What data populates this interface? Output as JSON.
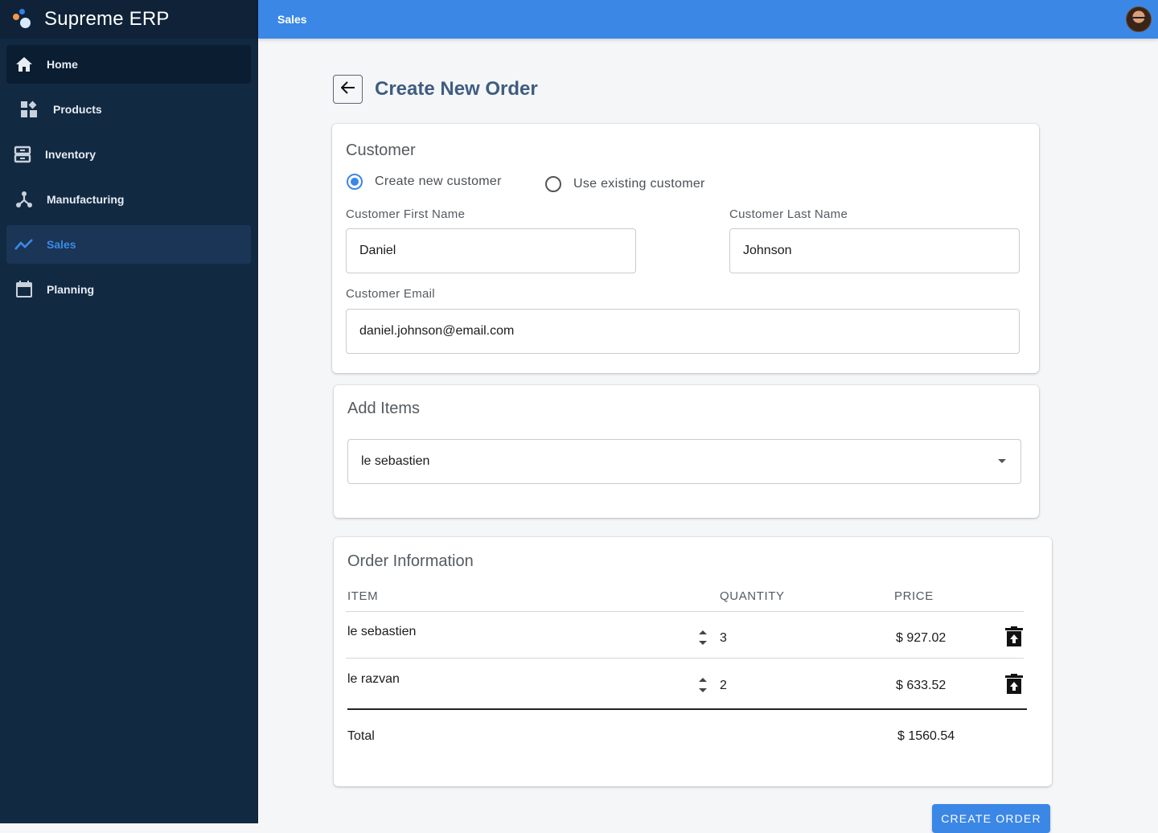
{
  "app": {
    "name": "Supreme ERP"
  },
  "sidebar": {
    "items": [
      {
        "label": "Home",
        "icon": "home-icon"
      },
      {
        "label": "Products",
        "icon": "products-icon"
      },
      {
        "label": "Inventory",
        "icon": "inventory-icon"
      },
      {
        "label": "Manufacturing",
        "icon": "manufacturing-icon"
      },
      {
        "label": "Sales",
        "icon": "trending-up-icon",
        "active": true
      },
      {
        "label": "Planning",
        "icon": "calendar-icon"
      }
    ]
  },
  "topbar": {
    "title": "Sales"
  },
  "page": {
    "title": "Create New Order"
  },
  "customer": {
    "title": "Customer",
    "radio_new": "Create new customer",
    "radio_existing": "Use existing customer",
    "selected": "new",
    "first_name_label": "Customer First Name",
    "first_name": "Daniel",
    "last_name_label": "Customer Last Name",
    "last_name": "Johnson",
    "email_label": "Customer Email",
    "email": "daniel.johnson@email.com"
  },
  "add_items": {
    "title": "Add Items",
    "selected_item": "le sebastien"
  },
  "order": {
    "title": "Order Information",
    "headers": {
      "item": "ITEM",
      "quantity": "QUANTITY",
      "price": "PRICE"
    },
    "rows": [
      {
        "item": "le sebastien",
        "quantity": "3",
        "price": "$ 927.02"
      },
      {
        "item": "le razvan",
        "quantity": "2",
        "price": "$ 633.52"
      }
    ],
    "total_label": "Total",
    "total_value": "$ 1560.54"
  },
  "actions": {
    "create_order": "CREATE ORDER"
  },
  "colors": {
    "sidebar_bg": "#122942",
    "accent": "#3b87e6",
    "title": "#3f5d80"
  }
}
